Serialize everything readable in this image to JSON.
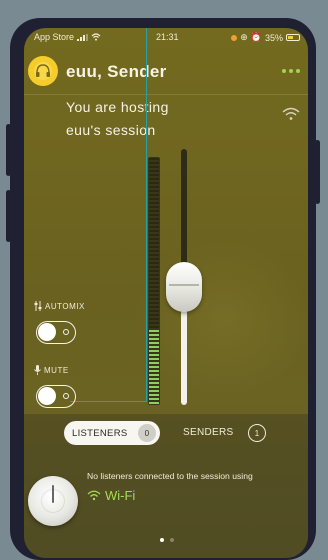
{
  "status_bar": {
    "carrier": "App Store",
    "time": "21:31",
    "battery": "35%"
  },
  "header": {
    "title": "euu, Sender",
    "avatar_icon": "headphones-icon",
    "menu_icon": "more-dots-icon"
  },
  "session": {
    "line1": "You are hosting",
    "line2": "euu's session"
  },
  "controls": {
    "automix_label": "AUTOMIX",
    "automix_on": false,
    "mute_label": "MUTE",
    "mute_on": false,
    "volume_level": 0.45,
    "meter_level": 0.3
  },
  "tabs": {
    "listeners_label": "LISTENERS",
    "listeners_count": "0",
    "senders_label": "SENDERS",
    "senders_count": "1"
  },
  "listeners_panel": {
    "message": "No listeners connected to the session using",
    "network": "Wi-Fi"
  },
  "colors": {
    "accent_green": "#a4dc53",
    "background": "#6e6520",
    "avatar": "#f4cc2c"
  }
}
